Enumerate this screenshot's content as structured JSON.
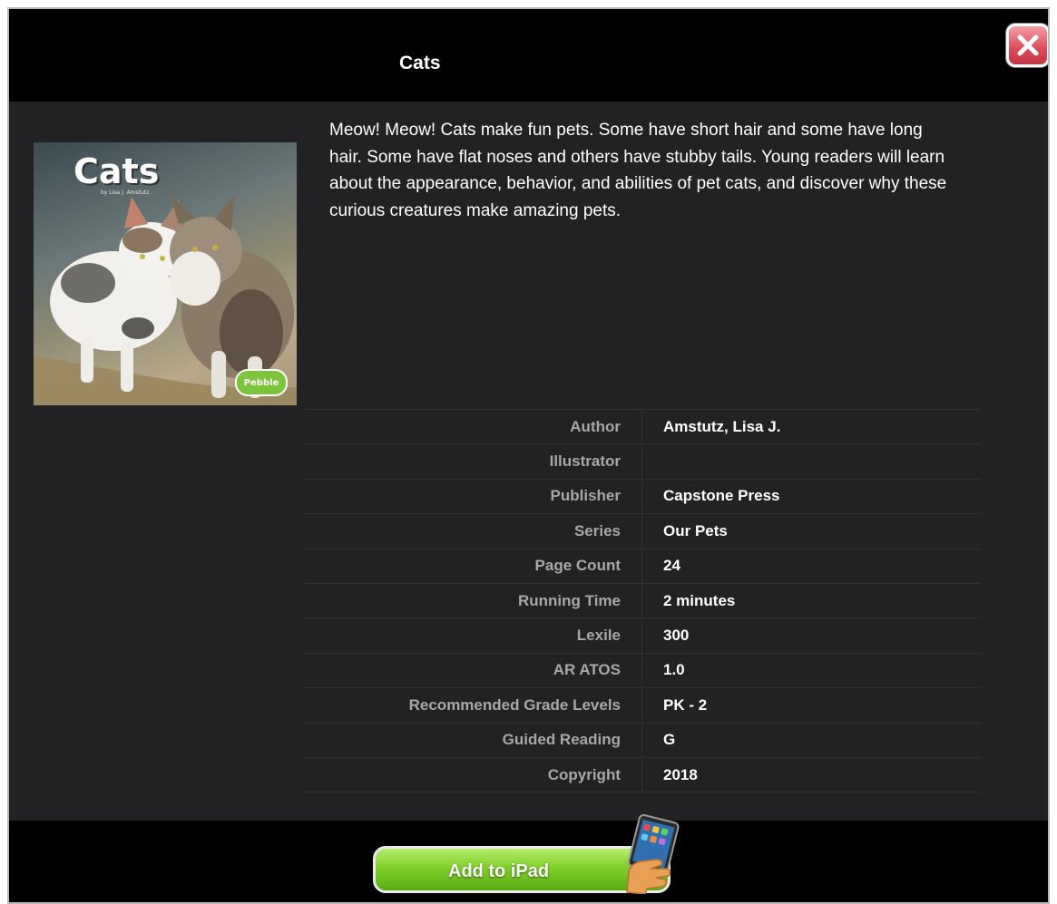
{
  "header": {
    "title": "Cats",
    "close_icon": "close-icon"
  },
  "cover": {
    "title": "Cats",
    "byline": "by Lisa J. Amstutz",
    "badge": "Pebble"
  },
  "description": "Meow! Meow! Cats make fun pets. Some have short hair and some have long hair. Some have flat noses and others have stubby tails. Young readers will learn about the appearance, behavior, and abilities of pet cats, and discover why these curious creatures make amazing pets.",
  "details": [
    {
      "label": "Author",
      "value": "Amstutz, Lisa J."
    },
    {
      "label": "Illustrator",
      "value": ""
    },
    {
      "label": "Publisher",
      "value": "Capstone Press"
    },
    {
      "label": "Series",
      "value": "Our Pets"
    },
    {
      "label": "Page Count",
      "value": "24"
    },
    {
      "label": "Running Time",
      "value": "2 minutes"
    },
    {
      "label": "Lexile",
      "value": "300"
    },
    {
      "label": "AR ATOS",
      "value": "1.0"
    },
    {
      "label": "Recommended Grade Levels",
      "value": "PK - 2"
    },
    {
      "label": "Guided Reading",
      "value": "G"
    },
    {
      "label": "Copyright",
      "value": "2018"
    }
  ],
  "footer": {
    "add_button_label": "Add to iPad",
    "ipad_icon": "ipad-icon"
  },
  "colors": {
    "background": "#222224",
    "bar": "#000000",
    "button_green": "#7fcf2b",
    "close_red": "#d94b59"
  }
}
